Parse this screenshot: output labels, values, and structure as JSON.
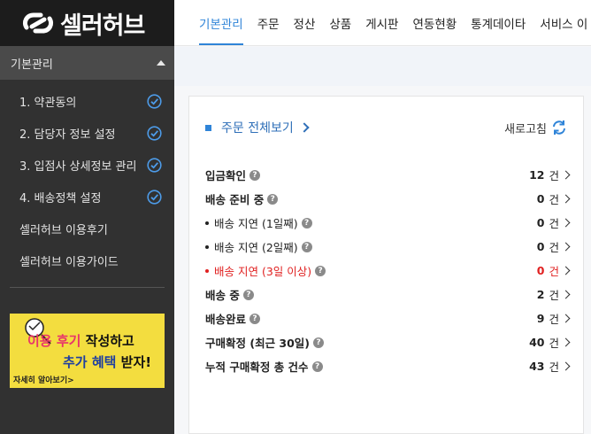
{
  "brand": {
    "name": "셀러허브"
  },
  "sidebar": {
    "section_title": "기본관리",
    "items": [
      {
        "label": "1. 약관동의",
        "checked": true
      },
      {
        "label": "2. 담당자 정보 설정",
        "checked": true
      },
      {
        "label": "3. 입점사 상세정보 관리",
        "checked": true
      },
      {
        "label": "4. 배송정책 설정",
        "checked": true
      },
      {
        "label": "셀러허브 이용후기",
        "checked": false
      },
      {
        "label": "셀러허브 이용가이드",
        "checked": false
      }
    ],
    "banner": {
      "line1_pink": "이용 후기",
      "line1_rest": " 작성하고",
      "line2_blue": "추가 혜택",
      "line2_rest": " 받자!",
      "more": "자세히 알아보기>"
    }
  },
  "topnav": {
    "items": [
      "기본관리",
      "주문",
      "정산",
      "상품",
      "게시판",
      "연동현황",
      "통계데이타",
      "서비스 이"
    ],
    "active_index": 0
  },
  "panel": {
    "title": "주문 전체보기",
    "refresh_label": "새로고침",
    "unit": "건",
    "rows": [
      {
        "label": "입금확인",
        "count": "12",
        "bold": true,
        "bullet": false,
        "red": false
      },
      {
        "label": "배송 준비 중",
        "count": "0",
        "bold": true,
        "bullet": false,
        "red": false
      },
      {
        "label": "배송 지연 (1일째)",
        "count": "0",
        "bold": false,
        "bullet": true,
        "red": false
      },
      {
        "label": "배송 지연 (2일째)",
        "count": "0",
        "bold": false,
        "bullet": true,
        "red": false
      },
      {
        "label": "배송 지연 (3일 이상)",
        "count": "0",
        "bold": false,
        "bullet": true,
        "red": true
      },
      {
        "label": "배송 중",
        "count": "2",
        "bold": true,
        "bullet": false,
        "red": false
      },
      {
        "label": "배송완료",
        "count": "9",
        "bold": true,
        "bullet": false,
        "red": false
      },
      {
        "label": "구매확정 (최근 30일)",
        "count": "40",
        "bold": true,
        "bullet": false,
        "red": false
      },
      {
        "label": "누적 구매확정 총 건수",
        "count": "43",
        "bold": true,
        "bullet": false,
        "red": false
      }
    ]
  },
  "colors": {
    "accent": "#2f84d8",
    "alert": "#e02020",
    "sidebar": "#313131"
  }
}
